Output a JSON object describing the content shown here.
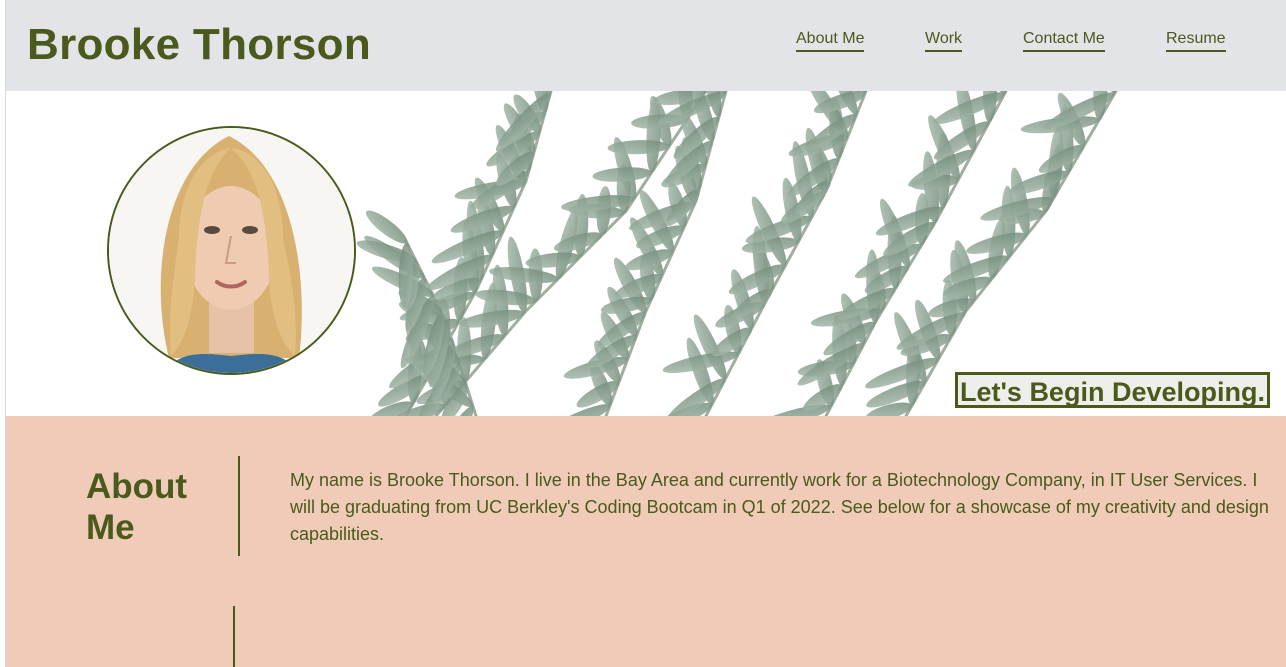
{
  "header": {
    "title": "Brooke Thorson",
    "nav": [
      {
        "label": "About Me"
      },
      {
        "label": "Work"
      },
      {
        "label": "Contact Me"
      },
      {
        "label": "Resume"
      }
    ]
  },
  "hero": {
    "tagline": "Let's Begin Developing.",
    "background_image": "olive-branch-image",
    "avatar": "profile-photo"
  },
  "about": {
    "heading": "About Me",
    "text": "My name is Brooke Thorson. I live in the Bay Area and currently work for a Biotechnology Company, in IT User Services. I will be graduating from UC Berkley's Coding Bootcam in Q1 of 2022. See below for a showcase of my creativity and design capabilities."
  },
  "colors": {
    "accent": "#4a5a1c",
    "header_bg": "#e2e4e8",
    "about_bg": "#f0cbb8",
    "leaf": "#8fa596"
  }
}
